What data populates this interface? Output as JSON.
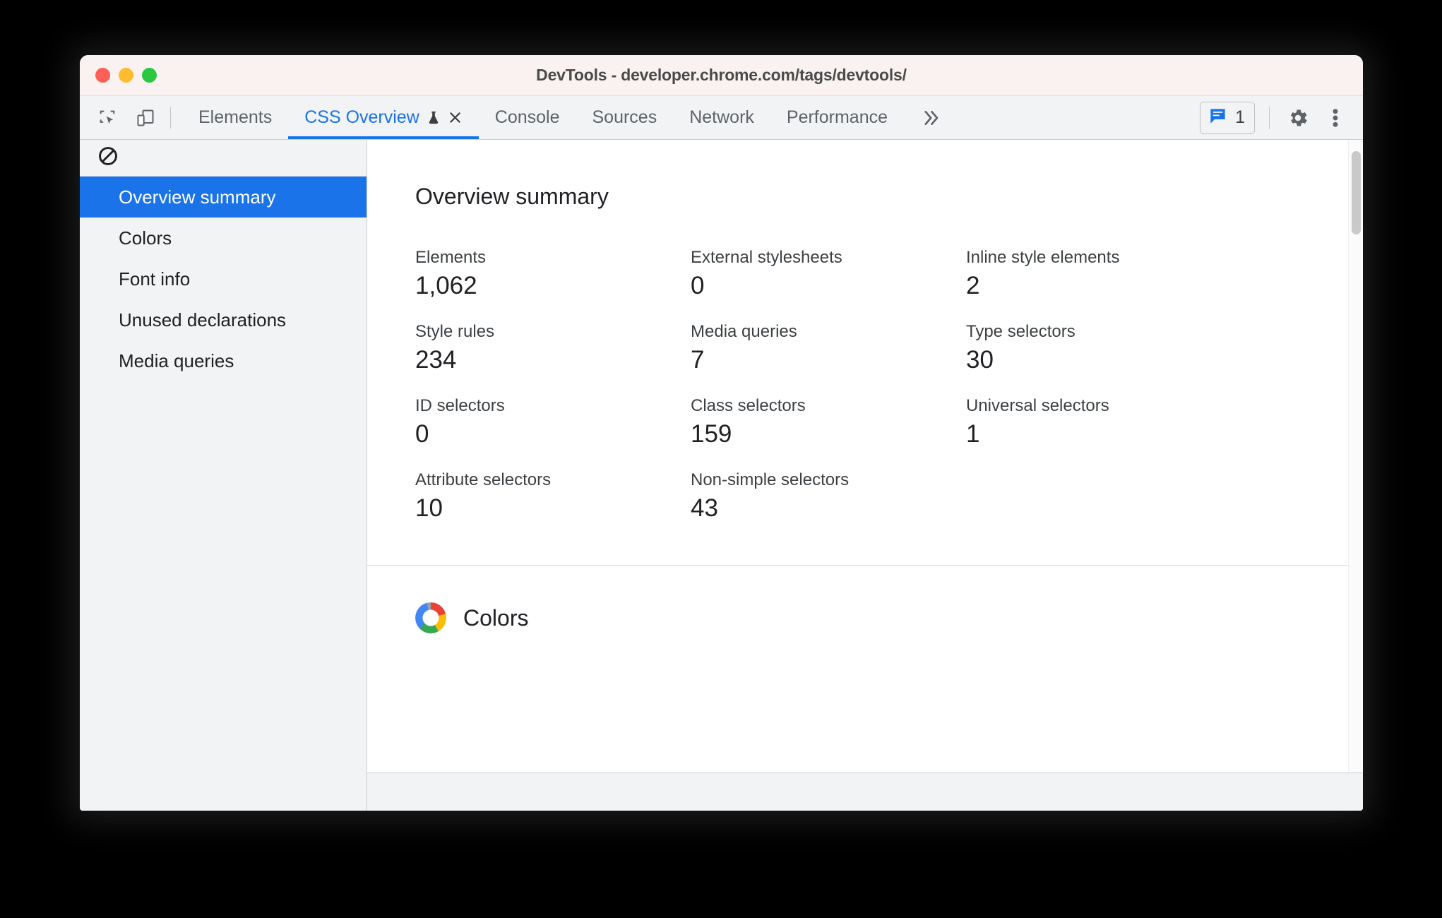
{
  "window": {
    "title": "DevTools - developer.chrome.com/tags/devtools/",
    "traffic_lights": [
      "close",
      "minimize",
      "maximize"
    ],
    "accent_color": "#1a73e8"
  },
  "toolbar": {
    "icons": [
      {
        "name": "inspect-element-icon",
        "label": "Inspect element"
      },
      {
        "name": "device-toolbar-icon",
        "label": "Toggle device toolbar"
      }
    ],
    "tabs": [
      {
        "label": "Elements",
        "active": false,
        "closable": false,
        "experimental": false
      },
      {
        "label": "CSS Overview",
        "active": true,
        "closable": true,
        "experimental": true
      },
      {
        "label": "Console",
        "active": false,
        "closable": false,
        "experimental": false
      },
      {
        "label": "Sources",
        "active": false,
        "closable": false,
        "experimental": false
      },
      {
        "label": "Network",
        "active": false,
        "closable": false,
        "experimental": false
      },
      {
        "label": "Performance",
        "active": false,
        "closable": false,
        "experimental": false
      }
    ],
    "overflow_label": "»",
    "issues": {
      "icon": "issues-message-icon",
      "count": "1",
      "color": "#1a73e8"
    },
    "settings_icon": "gear-icon",
    "more_icon": "three-dots-vertical-icon"
  },
  "sidebar": {
    "clear_icon": "no-entry-clear-icon",
    "items": [
      {
        "label": "Overview summary",
        "selected": true
      },
      {
        "label": "Colors",
        "selected": false
      },
      {
        "label": "Font info",
        "selected": false
      },
      {
        "label": "Unused declarations",
        "selected": false
      },
      {
        "label": "Media queries",
        "selected": false
      }
    ]
  },
  "main": {
    "summary": {
      "title": "Overview summary",
      "stats": [
        {
          "label": "Elements",
          "value": "1,062"
        },
        {
          "label": "External stylesheets",
          "value": "0"
        },
        {
          "label": "Inline style elements",
          "value": "2"
        },
        {
          "label": "Style rules",
          "value": "234"
        },
        {
          "label": "Media queries",
          "value": "7"
        },
        {
          "label": "Type selectors",
          "value": "30"
        },
        {
          "label": "ID selectors",
          "value": "0"
        },
        {
          "label": "Class selectors",
          "value": "159"
        },
        {
          "label": "Universal selectors",
          "value": "1"
        },
        {
          "label": "Attribute selectors",
          "value": "10"
        },
        {
          "label": "Non-simple selectors",
          "value": "43"
        }
      ]
    },
    "colors": {
      "title": "Colors",
      "icon": "color-wheel-icon"
    }
  }
}
